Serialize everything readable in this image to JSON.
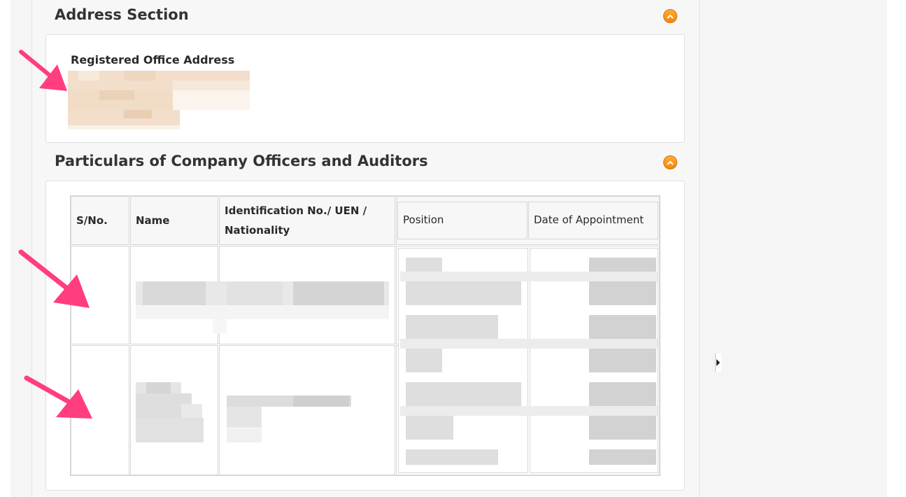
{
  "address_section": {
    "title": "Address Section",
    "field_label": "Registered Office Address"
  },
  "officers_section": {
    "title": "Particulars of Company Officers and Auditors",
    "columns": {
      "sno": "S/No.",
      "name": "Name",
      "id_line1": "Identification No./ UEN /",
      "id_line2": "Nationality",
      "position": "Position",
      "date": "Date of Appointment"
    }
  },
  "colors": {
    "accent_orange": "#f59a1c",
    "annotation_arrow": "#ff3d7f"
  },
  "icons": [
    "collapse-up-icon",
    "annotation-arrow",
    "scroll-right-icon"
  ]
}
